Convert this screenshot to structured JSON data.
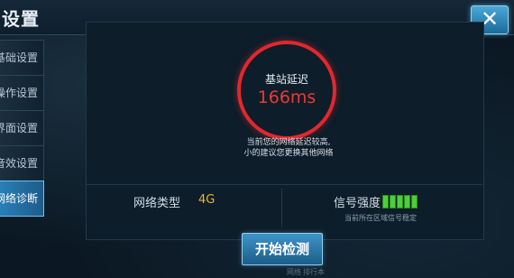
{
  "title": "设置",
  "sidebar": {
    "items": [
      {
        "label": "基础设置"
      },
      {
        "label": "操作设置"
      },
      {
        "label": "界面设置"
      },
      {
        "label": "音效设置"
      },
      {
        "label": "网络诊断"
      }
    ]
  },
  "diagnosis": {
    "ping_label": "基站延迟",
    "ping_value": "166ms",
    "warning_line1": "当前您的网络延迟较高,",
    "warning_line2": "小的建议您更换其他网络",
    "network_type_label": "网络类型",
    "network_type_value": "4G",
    "signal_label": "信号强度",
    "signal_subtext": "当前所在区域信号稳定",
    "signal_bars": 5
  },
  "start_button": "开始检测",
  "bottom_hints": [
    "网络",
    "排行本"
  ],
  "colors": {
    "accent_red": "#e0282e",
    "accent_gold": "#f0b030",
    "signal_green": "#4ccf3a"
  }
}
